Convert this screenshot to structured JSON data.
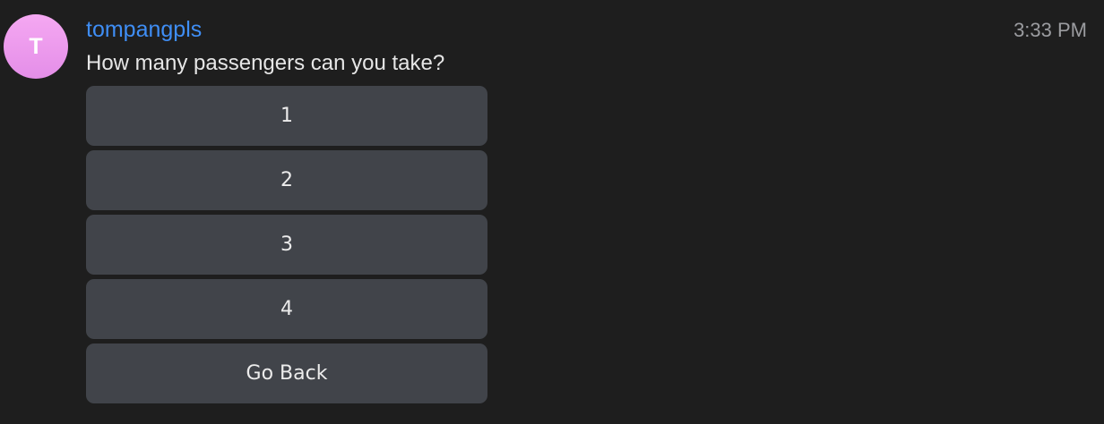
{
  "message": {
    "avatar_letter": "T",
    "sender": "tompangpls",
    "timestamp": "3:33 PM",
    "text": "How many passengers can you take?"
  },
  "keyboard": {
    "buttons": [
      "1",
      "2",
      "3",
      "4",
      "Go Back"
    ]
  },
  "colors": {
    "background": "#1e1e1e",
    "sender": "#3f8ef5",
    "button": "#41444a",
    "avatar": "#e48ee8"
  }
}
